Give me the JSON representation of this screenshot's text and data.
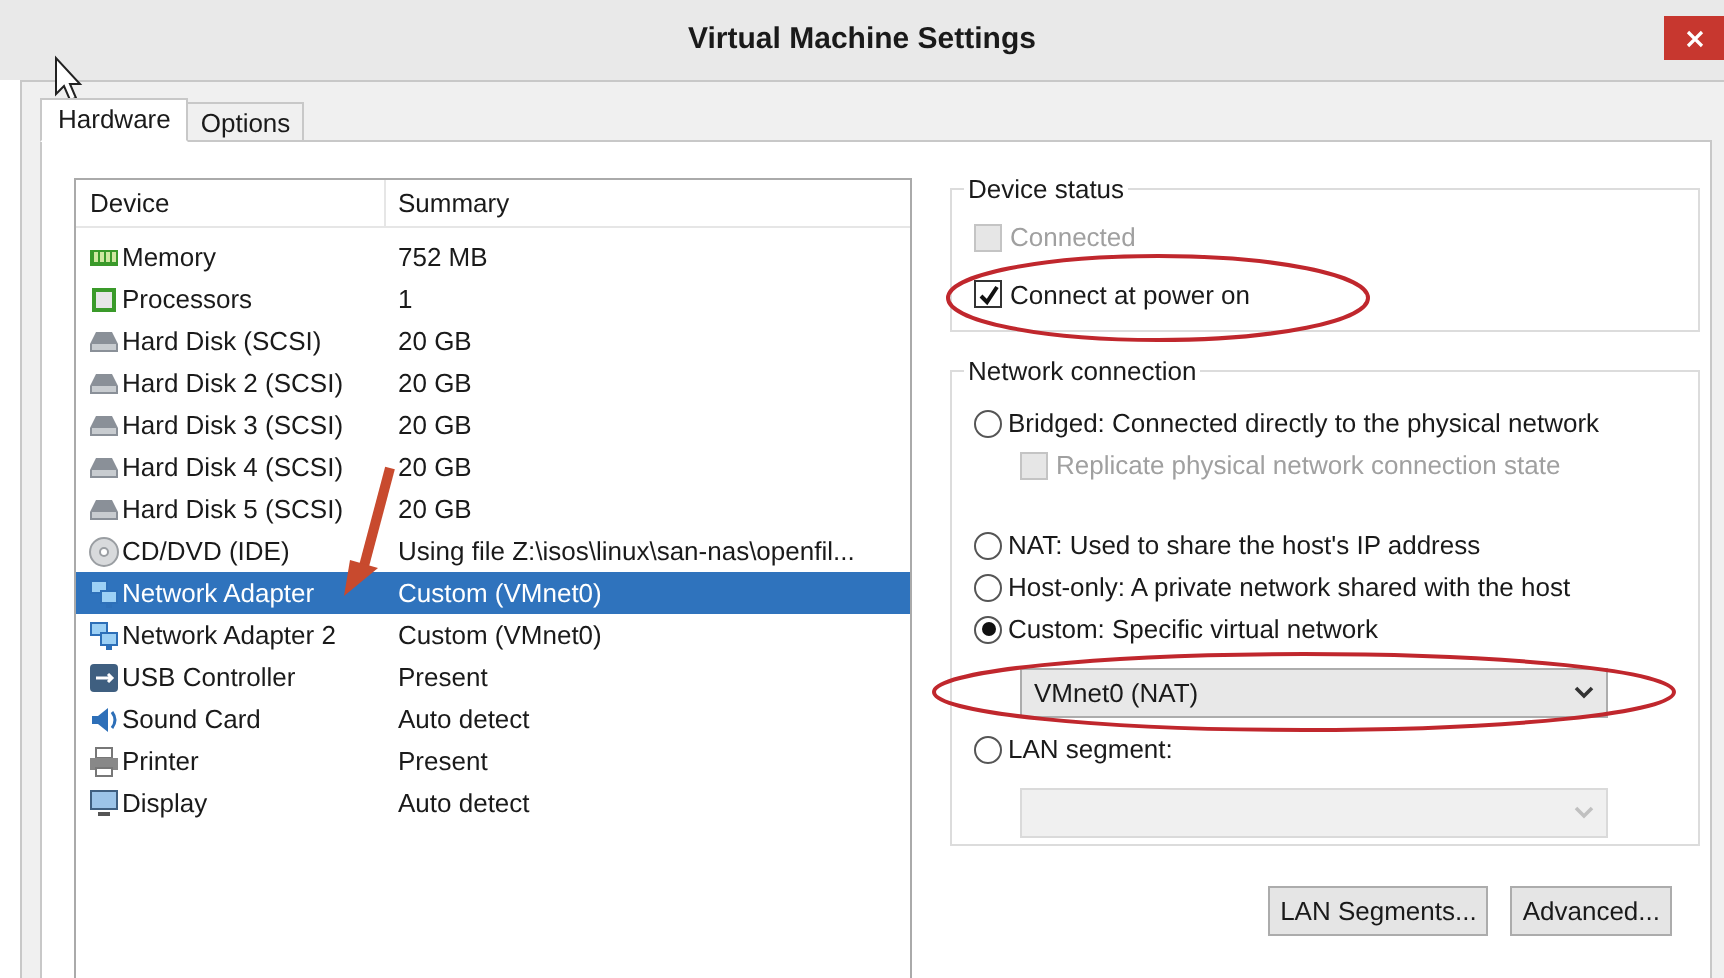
{
  "window": {
    "title": "Virtual Machine Settings"
  },
  "tabs": [
    {
      "label": "Hardware",
      "selected": true
    },
    {
      "label": "Options",
      "selected": false
    }
  ],
  "device_table": {
    "columns": [
      "Device",
      "Summary"
    ],
    "rows": [
      {
        "kind": "memory",
        "device": "Memory",
        "summary": "752 MB",
        "selected": false
      },
      {
        "kind": "cpu",
        "device": "Processors",
        "summary": "1",
        "selected": false
      },
      {
        "kind": "disk",
        "device": "Hard Disk (SCSI)",
        "summary": "20 GB",
        "selected": false
      },
      {
        "kind": "disk",
        "device": "Hard Disk 2 (SCSI)",
        "summary": "20 GB",
        "selected": false
      },
      {
        "kind": "disk",
        "device": "Hard Disk 3 (SCSI)",
        "summary": "20 GB",
        "selected": false
      },
      {
        "kind": "disk",
        "device": "Hard Disk 4 (SCSI)",
        "summary": "20 GB",
        "selected": false
      },
      {
        "kind": "disk",
        "device": "Hard Disk 5 (SCSI)",
        "summary": "20 GB",
        "selected": false
      },
      {
        "kind": "disc",
        "device": "CD/DVD (IDE)",
        "summary": "Using file Z:\\isos\\linux\\san-nas\\openfil...",
        "selected": false
      },
      {
        "kind": "network",
        "device": "Network Adapter",
        "summary": "Custom (VMnet0)",
        "selected": true
      },
      {
        "kind": "network",
        "device": "Network Adapter 2",
        "summary": "Custom (VMnet0)",
        "selected": false
      },
      {
        "kind": "usb",
        "device": "USB Controller",
        "summary": "Present",
        "selected": false
      },
      {
        "kind": "sound",
        "device": "Sound Card",
        "summary": "Auto detect",
        "selected": false
      },
      {
        "kind": "printer",
        "device": "Printer",
        "summary": "Present",
        "selected": false
      },
      {
        "kind": "display",
        "device": "Display",
        "summary": "Auto detect",
        "selected": false
      }
    ]
  },
  "device_status": {
    "title": "Device status",
    "checkboxes": [
      {
        "label": "Connected",
        "checked": false,
        "disabled": true
      },
      {
        "label": "Connect at power on",
        "checked": true,
        "disabled": false
      }
    ]
  },
  "network_connection": {
    "title": "Network connection",
    "options": [
      {
        "label": "Bridged: Connected directly to the physical network",
        "selected": false,
        "sub_checkbox": {
          "label": "Replicate physical network connection state",
          "checked": false,
          "disabled": true
        }
      },
      {
        "label": "NAT: Used to share the host's IP address",
        "selected": false
      },
      {
        "label": "Host-only: A private network shared with the host",
        "selected": false
      },
      {
        "label": "Custom: Specific virtual network",
        "selected": true,
        "dropdown": {
          "value": "VMnet0 (NAT)",
          "disabled": false
        }
      },
      {
        "label": "LAN segment:",
        "selected": false,
        "dropdown": {
          "disabled": true
        }
      }
    ]
  },
  "buttons": [
    "LAN Segments...",
    "Advanced..."
  ]
}
